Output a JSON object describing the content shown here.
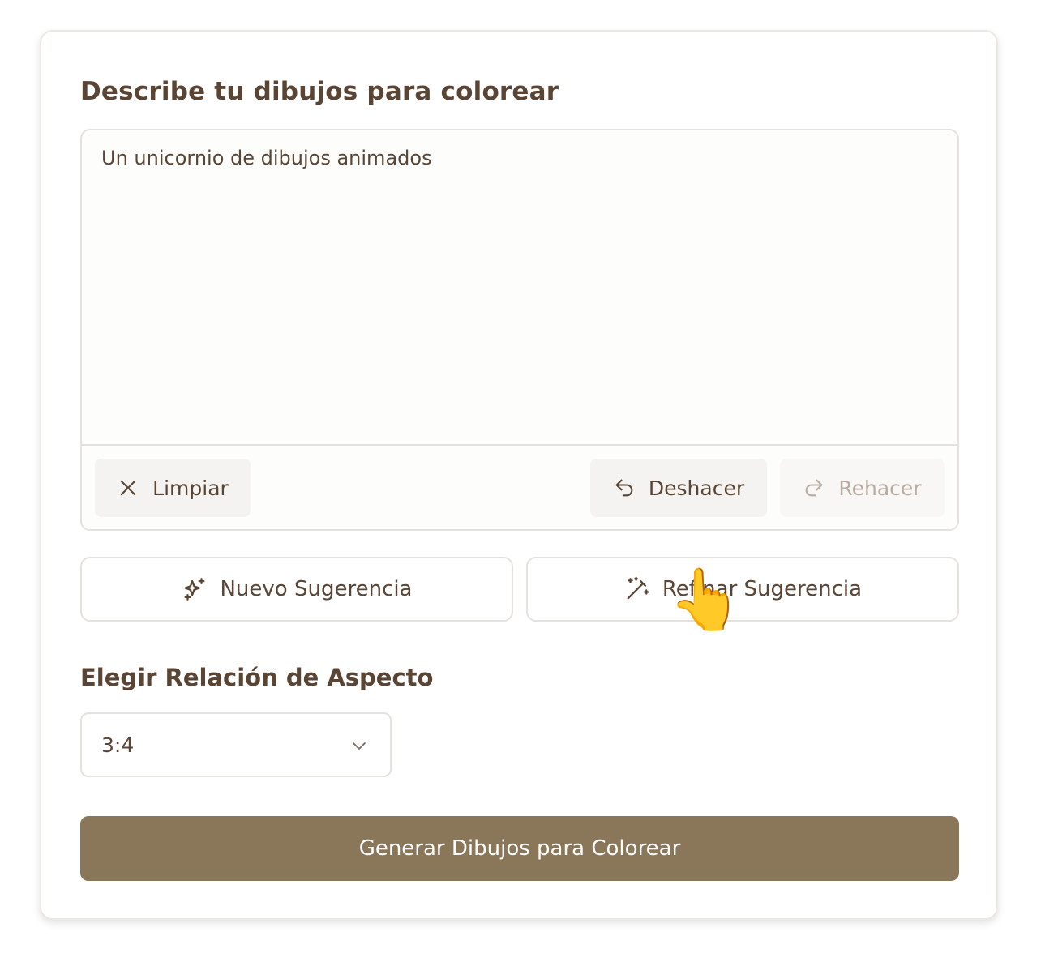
{
  "heading": "Describe tu dibujos para colorear",
  "prompt": {
    "value": "Un unicornio de dibujos animados"
  },
  "toolbar": {
    "clear_label": "Limpiar",
    "undo_label": "Deshacer",
    "redo_label": "Rehacer"
  },
  "suggestions": {
    "new_label": "Nuevo Sugerencia",
    "refine_label": "Refinar Sugerencia"
  },
  "aspect": {
    "label": "Elegir Relación de Aspecto",
    "selected": "3:4"
  },
  "generate_label": "Generar Dibujos para Colorear",
  "pointer_emoji": "👆",
  "colors": {
    "text": "#5a4535",
    "primary_button": "#8a7659",
    "disabled_text": "#b8aca1",
    "border": "#e5e2de"
  },
  "icons": [
    "close-icon",
    "undo-icon",
    "redo-icon",
    "sparkles-icon",
    "magic-wand-icon",
    "chevron-down-icon"
  ]
}
